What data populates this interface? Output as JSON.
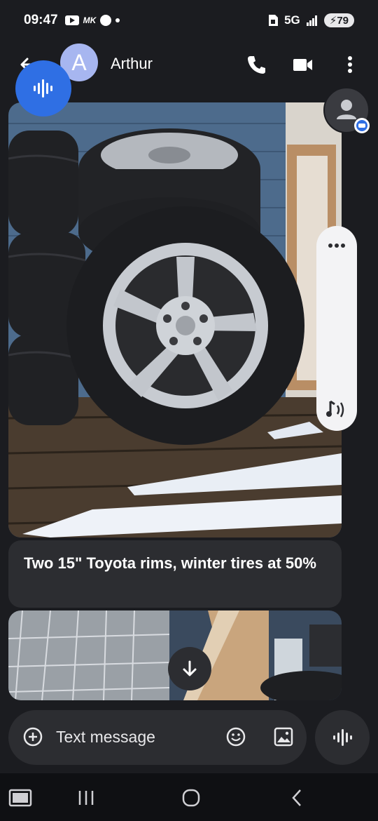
{
  "status_bar": {
    "time": "09:47",
    "mk_label": "MK",
    "network": "5G",
    "battery": "79"
  },
  "header": {
    "avatar_letter": "A",
    "contact_name": "Arthur"
  },
  "messages": [
    {
      "type": "image",
      "subject": "tires-on-deck"
    },
    {
      "type": "text",
      "text": "Two 15\" Toyota rims, winter tires at 50%"
    },
    {
      "type": "image",
      "subject": "tarp-and-wood"
    }
  ],
  "composer": {
    "placeholder": "Text message"
  },
  "icons": {
    "back": "arrow-left-icon",
    "call": "phone-icon",
    "video": "video-icon",
    "more": "more-vert-icon",
    "voice": "voice-wave-icon",
    "add": "add-circle-icon",
    "emoji": "emoji-icon",
    "gallery": "image-icon",
    "scroll_down": "arrow-down-icon",
    "recents": "recents-icon",
    "home": "home-icon",
    "nav_back": "chevron-left-icon"
  },
  "colors": {
    "background": "#1b1c20",
    "bubble": "#2c2d31",
    "accent": "#2f6fe4",
    "avatar": "#a7b6f0"
  }
}
